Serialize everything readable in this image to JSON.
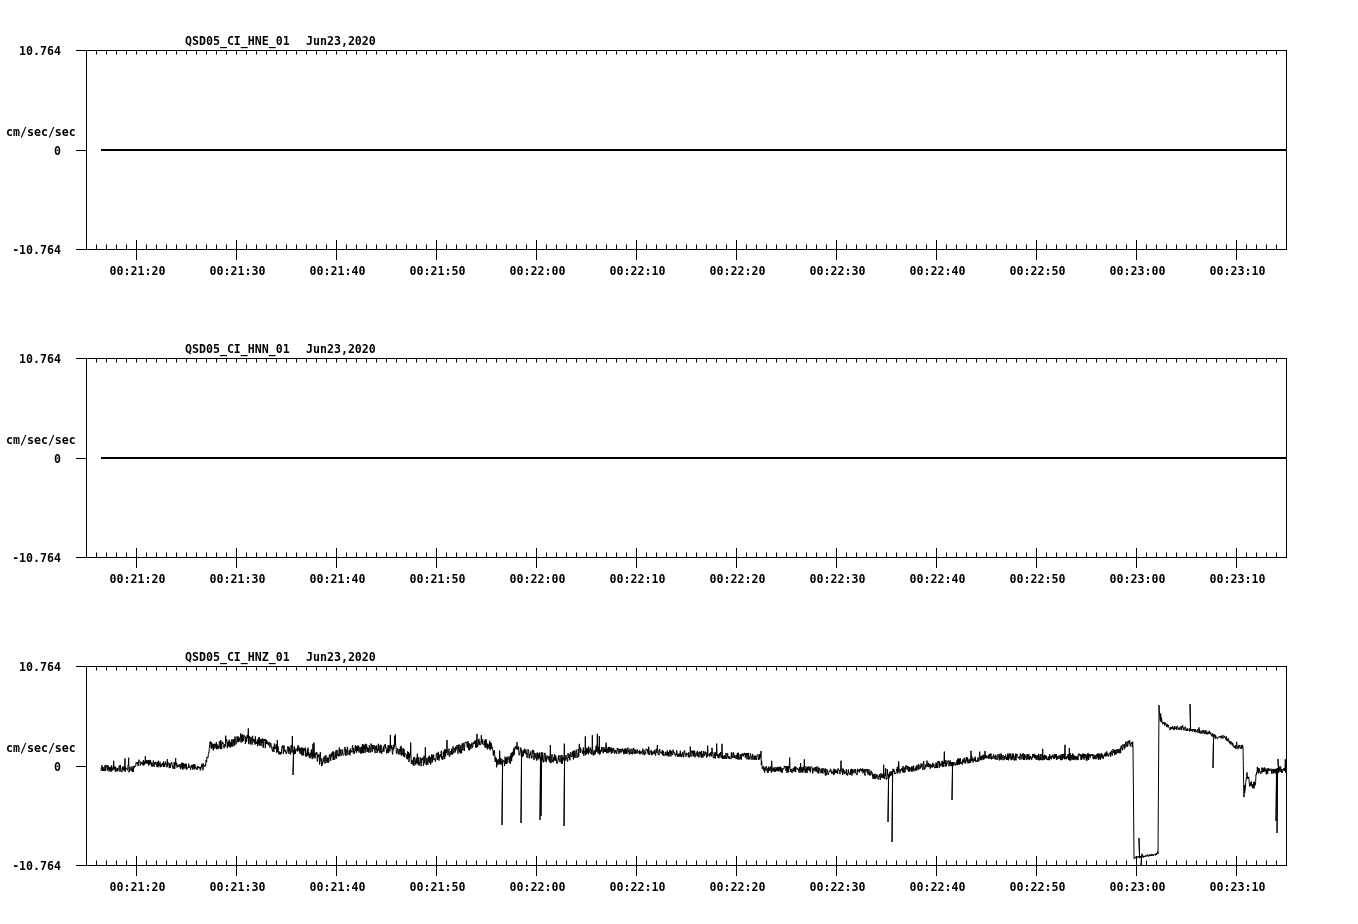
{
  "panels": [
    {
      "channel": "QSD05_CI_HNE_01",
      "date": "Jun23,2020",
      "ylabel": "cm/sec/sec",
      "yticks": [
        "10.764",
        "0",
        "-10.764"
      ],
      "xticks": [
        "00:21:20",
        "00:21:30",
        "00:21:40",
        "00:21:50",
        "00:22:00",
        "00:22:10",
        "00:22:20",
        "00:22:30",
        "00:22:40",
        "00:22:50",
        "00:23:00",
        "00:23:10"
      ],
      "kind": "flat"
    },
    {
      "channel": "QSD05_CI_HNN_01",
      "date": "Jun23,2020",
      "ylabel": "cm/sec/sec",
      "yticks": [
        "10.764",
        "0",
        "-10.764"
      ],
      "xticks": [
        "00:21:20",
        "00:21:30",
        "00:21:40",
        "00:21:50",
        "00:22:00",
        "00:22:10",
        "00:22:20",
        "00:22:30",
        "00:22:40",
        "00:22:50",
        "00:23:00",
        "00:23:10"
      ],
      "kind": "flat"
    },
    {
      "channel": "QSD05_CI_HNZ_01",
      "date": "Jun23,2020",
      "ylabel": "cm/sec/sec",
      "yticks": [
        "10.764",
        "0",
        "-10.764"
      ],
      "xticks": [
        "00:21:20",
        "00:21:30",
        "00:21:40",
        "00:21:50",
        "00:22:00",
        "00:22:10",
        "00:22:20",
        "00:22:30",
        "00:22:40",
        "00:22:50",
        "00:23:00",
        "00:23:10"
      ],
      "kind": "waveform"
    }
  ]
}
